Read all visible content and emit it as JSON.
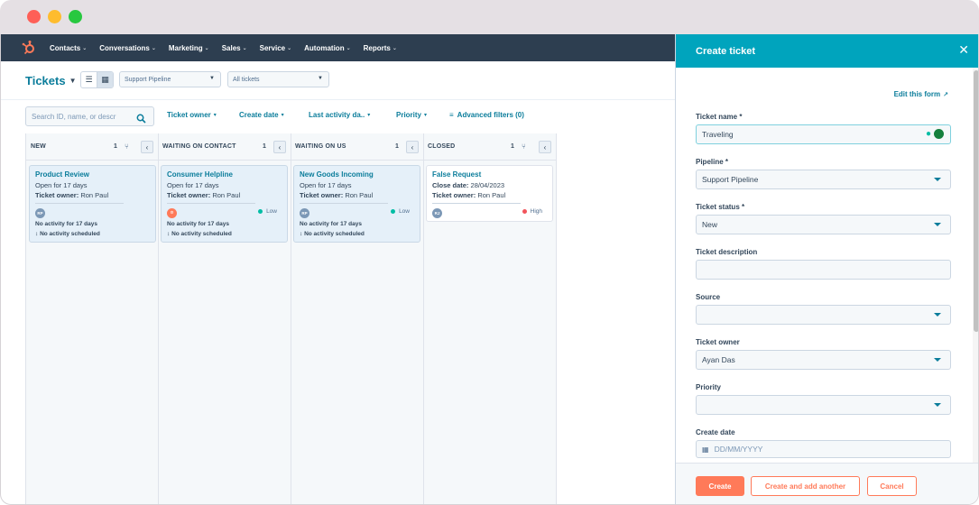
{
  "nav": {
    "items": [
      "Contacts",
      "Conversations",
      "Marketing",
      "Sales",
      "Service",
      "Automation",
      "Reports"
    ]
  },
  "toolbar": {
    "title": "Tickets",
    "pipeline_select": "Support Pipeline",
    "view_select": "All tickets",
    "search_placeholder": "Search ID, name, or descr",
    "filters": [
      "Ticket owner",
      "Create date",
      "Last activity da..",
      "Priority"
    ],
    "advanced_filters": "Advanced filters (0)"
  },
  "board": {
    "columns": [
      {
        "title": "NEW",
        "count": "1",
        "card": {
          "title": "Product Review",
          "line1": "Open for 17 days",
          "owner_label": "Ticket owner:",
          "owner": "Ron Paul",
          "avatar": "RP",
          "priority": "",
          "priority_color": "",
          "activity": "No activity for 17 days",
          "scheduled": "No activity scheduled"
        }
      },
      {
        "title": "WAITING ON CONTACT",
        "count": "1",
        "card": {
          "title": "Consumer Helpline",
          "line1": "Open for 17 days",
          "owner_label": "Ticket owner:",
          "owner": "Ron Paul",
          "avatar": "",
          "priority": "Low",
          "priority_color": "#00bda5",
          "activity": "No activity for 17 days",
          "scheduled": "No activity scheduled"
        }
      },
      {
        "title": "WAITING ON US",
        "count": "1",
        "card": {
          "title": "New Goods Incoming",
          "line1": "Open for 17 days",
          "owner_label": "Ticket owner:",
          "owner": "Ron Paul",
          "avatar": "RP",
          "priority": "Low",
          "priority_color": "#00bda5",
          "activity": "No activity for 17 days",
          "scheduled": "No activity scheduled"
        }
      },
      {
        "title": "CLOSED",
        "count": "1",
        "card": {
          "title": "False Request",
          "line1_label": "Close date:",
          "line1": "28/04/2023",
          "owner_label": "Ticket owner:",
          "owner": "Ron Paul",
          "avatar": "RJ",
          "priority": "High",
          "priority_color": "#f2545b"
        }
      }
    ]
  },
  "panel": {
    "title": "Create ticket",
    "edit_form": "Edit this form",
    "fields": {
      "ticket_name_label": "Ticket name *",
      "ticket_name_value": "Traveling",
      "pipeline_label": "Pipeline *",
      "pipeline_value": "Support Pipeline",
      "status_label": "Ticket status *",
      "status_value": "New",
      "description_label": "Ticket description",
      "source_label": "Source",
      "owner_label": "Ticket owner",
      "owner_value": "Ayan Das",
      "priority_label": "Priority",
      "create_date_label": "Create date",
      "create_date_placeholder": "DD/MM/YYYY"
    },
    "buttons": {
      "create": "Create",
      "create_another": "Create and add another",
      "cancel": "Cancel"
    }
  },
  "colors": {
    "nav_bg": "#2d3e50",
    "accent_teal": "#00a4bd",
    "link": "#0b7d9b",
    "primary_button": "#ff7a59",
    "card_bg": "#e5f0f9"
  }
}
